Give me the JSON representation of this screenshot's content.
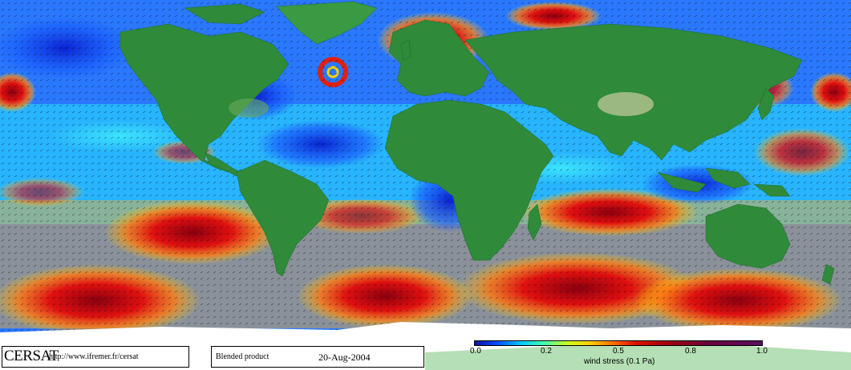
{
  "credit": {
    "logo": "CERSAT",
    "url": "http://www.ifremer.fr/cersat"
  },
  "product": {
    "name": "Blended product",
    "date": "20-Aug-2004"
  },
  "colorbar": {
    "label": "wind stress (0.1 Pa)",
    "ticks": [
      "0.0",
      "0.2",
      "0.5",
      "0.8",
      "1.0"
    ]
  },
  "colors": {
    "ocean_low": "#1a3cff",
    "ocean_mid": "#22c8ff",
    "ocean_high": "#d81010",
    "land": "#2f8a3a",
    "ice": "#ffffff"
  }
}
